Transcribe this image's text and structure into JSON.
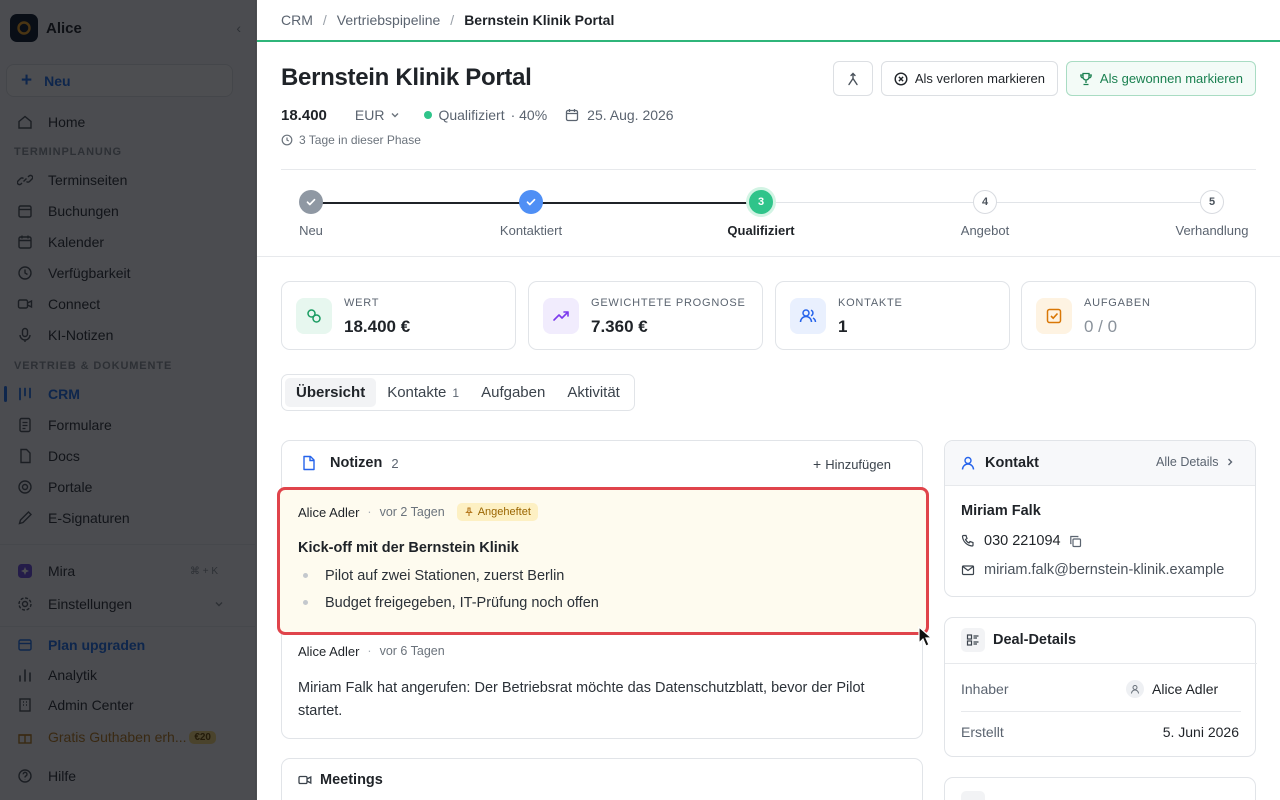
{
  "sidebar": {
    "workspace": "Alice",
    "new_label": "Neu",
    "home": "Home",
    "section_scheduling": "TERMINPLANUNG",
    "items_scheduling": [
      "Terminseiten",
      "Buchungen",
      "Kalender",
      "Verfügbarkeit",
      "Connect",
      "KI-Notizen"
    ],
    "section_sales": "VERTRIEB & DOKUMENTE",
    "items_sales": [
      "CRM",
      "Formulare",
      "Docs",
      "Portale",
      "E-Signaturen"
    ],
    "mira": "Mira",
    "mira_shortcut": "⌘ + K",
    "settings": "Einstellungen",
    "upgrade": "Plan upgraden",
    "analytics": "Analytik",
    "admin": "Admin Center",
    "credit": "Gratis Guthaben erh...",
    "credit_badge": "€20",
    "help": "Hilfe"
  },
  "breadcrumb": {
    "root": "CRM",
    "parent": "Vertriebspipeline",
    "current": "Bernstein Klinik Portal"
  },
  "deal": {
    "title": "Bernstein Klinik Portal",
    "value": "18.400",
    "currency": "EUR",
    "stage": "Qualifiziert",
    "probability": "· 40%",
    "close_date": "25. Aug. 2026",
    "phase_duration": "3 Tage in dieser Phase",
    "lost_label": "Als verloren markieren",
    "won_label": "Als gewonnen markieren"
  },
  "pipeline": {
    "steps": [
      {
        "label": "Neu",
        "state": "done",
        "num": ""
      },
      {
        "label": "Kontaktiert",
        "state": "done",
        "num": ""
      },
      {
        "label": "Qualifiziert",
        "state": "current",
        "num": "3"
      },
      {
        "label": "Angebot",
        "state": "todo",
        "num": "4"
      },
      {
        "label": "Verhandlung",
        "state": "todo",
        "num": "5"
      }
    ]
  },
  "stats": [
    {
      "label": "WERT",
      "value": "18.400 €",
      "color": "#1a9c62"
    },
    {
      "label": "GEWICHTETE PROGNOSE",
      "value": "7.360 €",
      "color": "#7c3aed"
    },
    {
      "label": "KONTAKTE",
      "value": "1",
      "color": "#2563eb"
    },
    {
      "label": "AUFGABEN",
      "value": "0 / 0",
      "color": "#d97706"
    }
  ],
  "tabs": {
    "overview": "Übersicht",
    "contacts": "Kontakte",
    "contacts_count": "1",
    "tasks": "Aufgaben",
    "activity": "Aktivität"
  },
  "notes": {
    "title": "Notizen",
    "count": "2",
    "add": "Hinzufügen",
    "items": [
      {
        "author": "Alice Adler",
        "time": "vor 2 Tagen",
        "pinned": "Angeheftet",
        "heading": "Kick-off mit der Bernstein Klinik",
        "bullets": [
          "Pilot auf zwei Stationen, zuerst Berlin",
          "Budget freigegeben, IT-Prüfung noch offen"
        ]
      },
      {
        "author": "Alice Adler",
        "time": "vor 6 Tagen",
        "body": "Miriam Falk hat angerufen: Der Betriebsrat möchte das Datenschutzblatt, bevor der Pilot startet."
      }
    ]
  },
  "meetings": {
    "title": "Meetings"
  },
  "contact": {
    "title": "Kontakt",
    "all_details": "Alle Details",
    "name": "Miriam Falk",
    "phone": "030 221094",
    "email": "miriam.falk@bernstein-klinik.example"
  },
  "deal_details": {
    "title": "Deal-Details",
    "owner_label": "Inhaber",
    "owner": "Alice Adler",
    "created_label": "Erstellt",
    "created": "5. Juni 2026"
  },
  "colors": {
    "accent": "#1f6feb",
    "success": "#2fc48a",
    "highlight": "#e0444b"
  }
}
